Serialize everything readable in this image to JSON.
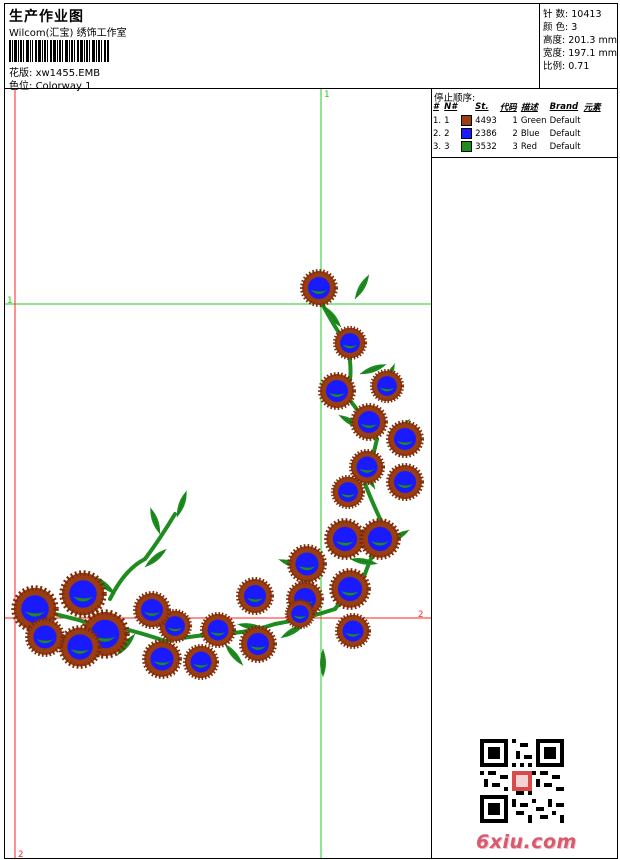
{
  "header": {
    "title": "生产作业图",
    "subtitle": "Wilcom(汇宝) 绣饰工作室",
    "design_label": "花版:",
    "design_value": "xw1455.EMB",
    "colorway_label": "色位:",
    "colorway_value": "Colorway 1"
  },
  "specs": {
    "stitches_label": "针 数:",
    "stitches_value": "10413",
    "colors_label": "颜 色:",
    "colors_value": "3",
    "height_label": "高度:",
    "height_value": "201.3 mm",
    "width_label": "宽度:",
    "width_value": "197.1 mm",
    "scale_label": "比例:",
    "scale_value": "0.71"
  },
  "stop_sequence": {
    "title": "停止顺序:",
    "headers": [
      "#",
      "N#",
      "St.",
      "代码",
      "描述",
      "Brand",
      "元素"
    ],
    "rows": [
      {
        "idx": "1.",
        "n": "1",
        "color": "#9a3d12",
        "st": "4493",
        "code": "1",
        "desc": "Green",
        "brand": "Default"
      },
      {
        "idx": "2.",
        "n": "2",
        "color": "#1a1aff",
        "st": "2386",
        "code": "2",
        "desc": "Blue",
        "brand": "Default"
      },
      {
        "idx": "3.",
        "n": "3",
        "color": "#1e8c1e",
        "st": "3532",
        "code": "3",
        "desc": "Red",
        "brand": "Default"
      }
    ]
  },
  "canvas": {
    "guide_v1_label": "1",
    "guide_h1_label": "1",
    "guide_h2_label": "2",
    "guide_v2_label": "2",
    "guide_green": "#22cc22",
    "guide_red": "#ff2222"
  },
  "watermark": "6xiu.com",
  "colors": {
    "brown": "#9a3d12",
    "blue": "#1a1aff",
    "green": "#1e8c1e"
  }
}
